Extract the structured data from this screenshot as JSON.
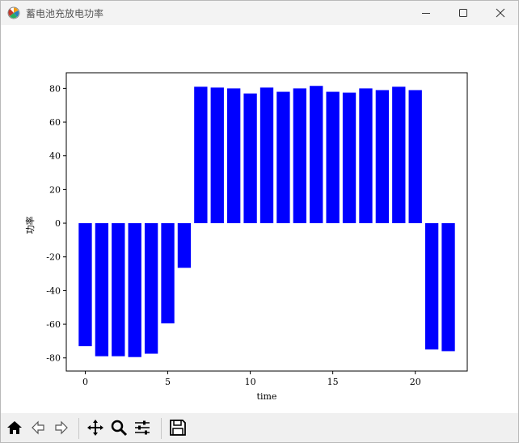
{
  "window": {
    "title": "蓄电池充放电功率",
    "icon": "matplotlib-icon",
    "controls": [
      "minimize-icon",
      "maximize-icon",
      "close-icon"
    ]
  },
  "toolbar": {
    "buttons": [
      "home-icon",
      "back-icon",
      "forward-icon",
      "pan-icon",
      "zoom-icon",
      "configure-subplots-icon",
      "save-icon"
    ]
  },
  "chart_data": {
    "type": "bar",
    "title": "",
    "xlabel": "time",
    "ylabel": "功率",
    "x": [
      0,
      1,
      2,
      3,
      4,
      5,
      6,
      7,
      8,
      9,
      10,
      11,
      12,
      13,
      14,
      15,
      16,
      17,
      18,
      19,
      20,
      21,
      22
    ],
    "values": [
      -73,
      -79,
      -79,
      -79.5,
      -77.5,
      -59.5,
      -26.5,
      81,
      80.5,
      80,
      77,
      80.5,
      78,
      80,
      81.5,
      78,
      77.5,
      80,
      79,
      81,
      79,
      -75,
      -76
    ],
    "bar_color": "#0000ff",
    "xlim": [
      -1.15,
      23.15
    ],
    "ylim": [
      -87.8,
      89.3
    ],
    "xticks": [
      0,
      5,
      10,
      15,
      20
    ],
    "yticks": [
      -80,
      -60,
      -40,
      -20,
      0,
      20,
      40,
      60,
      80
    ],
    "grid": false
  }
}
